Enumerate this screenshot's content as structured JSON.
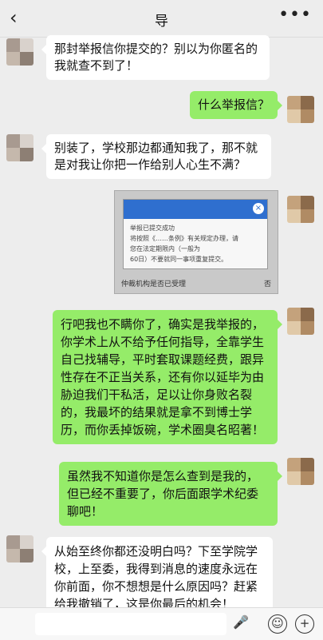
{
  "header": {
    "title": "导",
    "back_icon": "chevron-left-icon",
    "more_icon": "more-icon",
    "more_glyph": "•••",
    "back_glyph": "‹"
  },
  "messages": [
    {
      "side": "left",
      "text": "那封举报信你提交的？别以为你匿名的我就查不到了！"
    },
    {
      "side": "right",
      "text": "什么举报信？"
    },
    {
      "side": "left",
      "text": "别装了，学校那边都通知我了，那不就是对我让你把一作给别人心生不满？"
    },
    {
      "side": "right",
      "text": "行吧我也不瞒你了，确实是我举报的，你学术上从不给予任何指导，全靠学生自己找辅导，平时套取课题经费，跟异性存在不正当关系，还有你以延毕为由胁迫我们干私活，足以让你身败名裂的，我最坏的结果就是拿不到博士学历，而你丢掉饭碗，学术圈臭名昭著！"
    },
    {
      "side": "right",
      "text": "虽然我不知道你是怎么查到是我的，但已经不重要了，你后面跟学术纪委聊吧！"
    },
    {
      "side": "left",
      "text": "从始至终你都还没明白吗？下至学院学校，上至委，我得到消息的速度永远在你前面，你不想想是什么原因吗？赶紧给我撤销了，这是你最后的机会！"
    }
  ],
  "screenshot_card": {
    "line1": "举报已提交成功",
    "line2": "将按照《……条例》有关规定办理，请",
    "line3": "您在法定期限内（一般为",
    "line4": "60日）不要就同一事项重复提交。",
    "footer_left": "仲裁机构是否已受理",
    "footer_right": "否",
    "close_glyph": "×"
  },
  "colors": {
    "sent": "#95ec69",
    "received": "#ffffff",
    "background": "#ededed"
  },
  "input_bar": {
    "voice_icon": "microphone-icon",
    "emoji_icon": "emoji-icon",
    "plus_icon": "plus-icon",
    "voice_glyph": "🎤",
    "emoji_glyph": "☺",
    "plus_glyph": "+"
  }
}
